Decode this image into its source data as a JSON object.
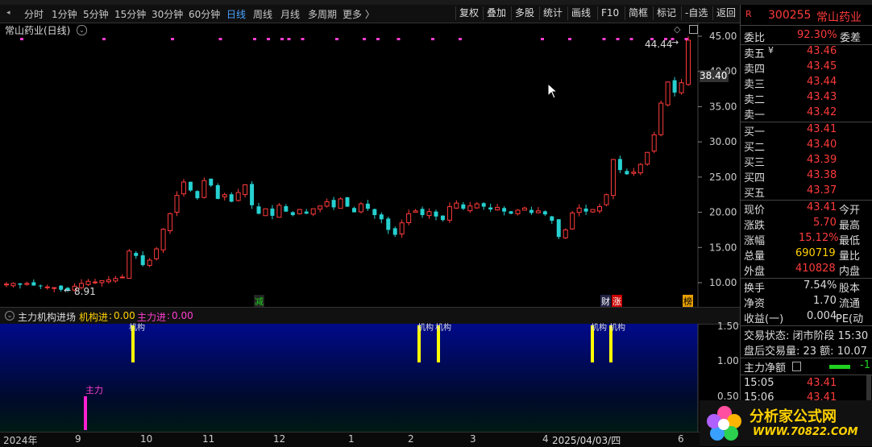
{
  "toolbar": {
    "periods": [
      "分时",
      "1分钟",
      "5分钟",
      "15分钟",
      "30分钟",
      "60分钟",
      "日线",
      "周线",
      "月线",
      "多周期",
      "更多 〉"
    ],
    "active_period": "日线",
    "buttons": [
      "复权",
      "叠加",
      "多股",
      "统计",
      "画线",
      "F10",
      "简框",
      "标记",
      "-自选",
      "返回"
    ]
  },
  "chart": {
    "title": "常山药业(日线)",
    "price_axis": [
      "45.00",
      "40.00",
      "35.00",
      "30.00",
      "25.00",
      "20.00",
      "15.00",
      "10.00"
    ],
    "current_price_tag": "38.40",
    "high_label": "44.44",
    "low_label": "8.91",
    "markers": [
      "减",
      "财",
      "涨",
      "榜"
    ],
    "colors": {
      "up": "#ff3b3b",
      "down": "#26d0d0",
      "magenta": "#ff3dd0",
      "yellow": "#ffff00"
    }
  },
  "chart_data": {
    "type": "candlestick",
    "title": "常山药业(日线)",
    "ylim": [
      8,
      46
    ],
    "price_ticks": [
      10,
      15,
      20,
      25,
      30,
      35,
      40,
      45
    ],
    "x_labels": [
      "2024年",
      "9",
      "10",
      "11",
      "12",
      "1",
      "2",
      "3",
      "4",
      "2025/04/03/四",
      "6"
    ],
    "closes": [
      9.8,
      9.9,
      9.7,
      9.9,
      9.6,
      9.5,
      9.4,
      9.3,
      9.0,
      8.91,
      9.5,
      9.9,
      10.2,
      10.1,
      10.3,
      10.4,
      10.6,
      10.8,
      14.5,
      13.8,
      12.5,
      13.2,
      14.8,
      17.6,
      19.8,
      22.4,
      24.3,
      23.1,
      22.0,
      24.5,
      23.8,
      21.9,
      22.5,
      21.5,
      22.8,
      23.9,
      21.0,
      19.8,
      20.5,
      19.5,
      21.0,
      20.1,
      19.6,
      20.4,
      19.8,
      20.5,
      20.9,
      21.5,
      20.7,
      21.9,
      20.8,
      20.0,
      21.2,
      20.5,
      19.6,
      19.0,
      17.5,
      16.8,
      18.5,
      19.8,
      20.2,
      19.6,
      20.1,
      19.4,
      18.9,
      20.8,
      21.3,
      20.5,
      20.9,
      21.2,
      20.8,
      20.4,
      20.7,
      20.1,
      19.8,
      20.3,
      20.6,
      19.9,
      20.2,
      19.7,
      18.8,
      16.5,
      17.5,
      19.9,
      20.6,
      20.1,
      20.4,
      20.8,
      22.5,
      27.5,
      26.0,
      25.4,
      25.7,
      26.8,
      28.5,
      31.0,
      35.5,
      38.5,
      37.0,
      38.4,
      44.44
    ],
    "indicator": {
      "name": "主力机构进场",
      "series": [
        {
          "name": "机构进",
          "value": "0.00"
        },
        {
          "name": "主力进",
          "value": "0.00"
        }
      ],
      "ticks": [
        "1.50",
        "1.00",
        "0.50"
      ],
      "bar_label_a": "机构",
      "bar_label_b": "主力"
    }
  },
  "quote": {
    "code": "300255",
    "name": "常山药业",
    "webi_label": "委比",
    "webi": "92.30%",
    "weicha_label": "委差",
    "asks": [
      {
        "label": "卖五",
        "price": "43.46"
      },
      {
        "label": "卖四",
        "price": "43.45"
      },
      {
        "label": "卖三",
        "price": "43.44"
      },
      {
        "label": "卖二",
        "price": "43.43"
      },
      {
        "label": "卖一",
        "price": "43.42"
      }
    ],
    "bids": [
      {
        "label": "买一",
        "price": "43.41"
      },
      {
        "label": "买二",
        "price": "43.40"
      },
      {
        "label": "买三",
        "price": "43.39"
      },
      {
        "label": "买四",
        "price": "43.38"
      },
      {
        "label": "买五",
        "price": "43.37"
      }
    ],
    "stats": [
      {
        "label": "现价",
        "value": "43.41",
        "label2": "今开"
      },
      {
        "label": "涨跌",
        "value": "5.70",
        "label2": "最高"
      },
      {
        "label": "涨幅",
        "value": "15.12%",
        "label2": "最低"
      },
      {
        "label": "总量",
        "value": "690719",
        "label2": "量比"
      },
      {
        "label": "外盘",
        "value": "410828",
        "label2": "内盘"
      }
    ],
    "stats2": [
      {
        "label": "换手",
        "value": "7.54%",
        "label2": "股本"
      },
      {
        "label": "净资",
        "value": "1.70",
        "label2": "流通"
      },
      {
        "label": "收益(一)",
        "value": "0.004",
        "label2": "PE(动"
      }
    ],
    "trade_status": "交易状态: 闭市阶段 15:30",
    "after_hours": "盘后交易量: 23  额: 10.07",
    "net_label": "主力净额",
    "net_value": "-1",
    "ticks": [
      {
        "time": "15:05",
        "price": "43.41"
      },
      {
        "time": "15:06",
        "price": "43.41"
      }
    ]
  },
  "logo": {
    "text": "分析家公式网",
    "url": "WWW.70822.COM"
  }
}
